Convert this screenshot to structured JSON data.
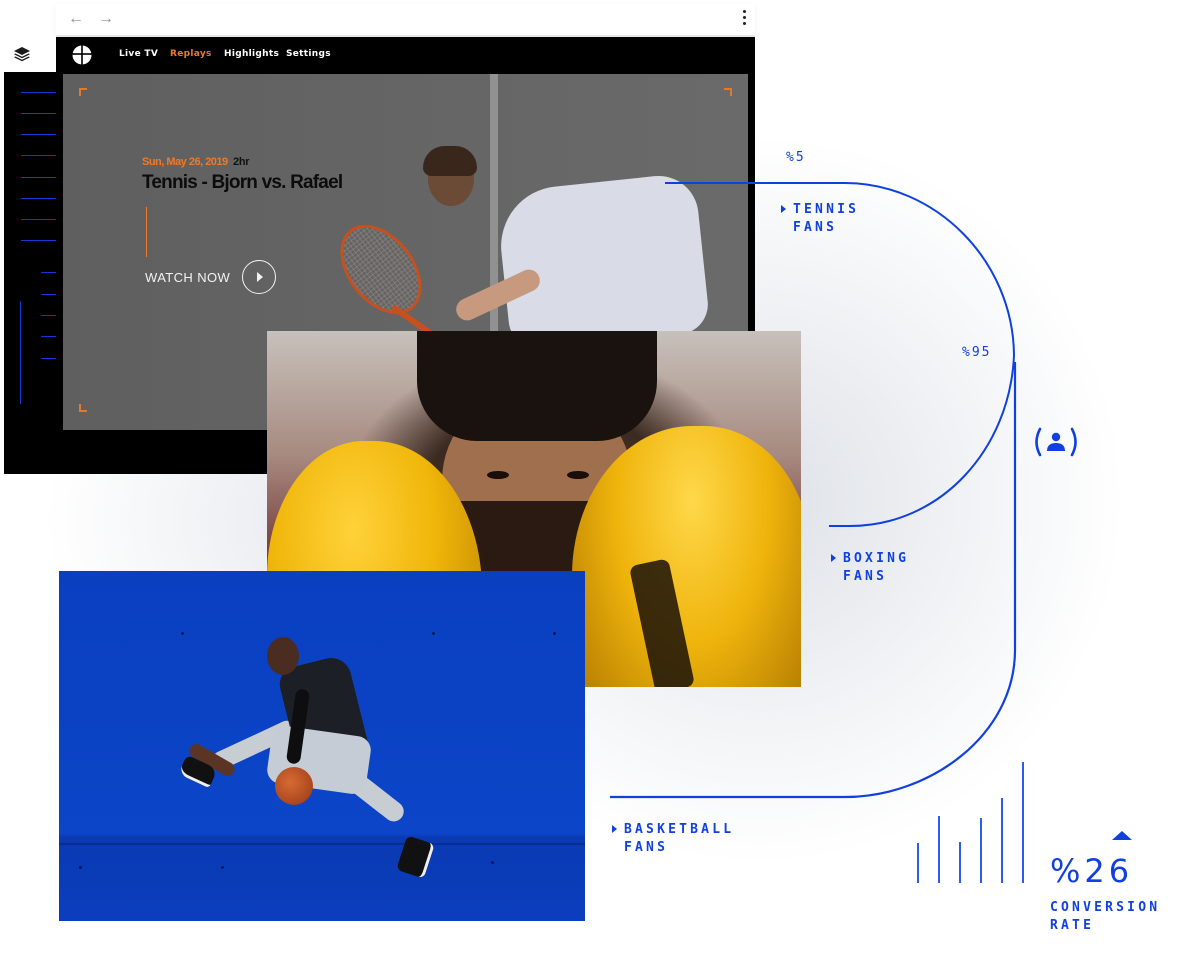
{
  "browser": {
    "back_icon": "←",
    "forward_icon": "→",
    "menu_icon": "kebab-menu"
  },
  "app": {
    "nav": [
      {
        "label": "Live TV",
        "active": false
      },
      {
        "label": "Replays",
        "active": true
      },
      {
        "label": "Highlights",
        "active": false
      },
      {
        "label": "Settings",
        "active": false
      }
    ],
    "accent_color": "#f0782a"
  },
  "hero": {
    "date": "Sun, May 26, 2019",
    "duration": "2hr",
    "title": "Tennis - Bjorn vs. Rafael",
    "cta_label": "WATCH NOW"
  },
  "audience": {
    "accent_color": "#1140e0",
    "segments": [
      {
        "percent_label": "%5",
        "line1": "TENNIS",
        "line2": "FANS"
      },
      {
        "percent_label": "%95",
        "line1": "BOXING",
        "line2": "FANS"
      },
      {
        "percent_label": "",
        "line1": "BASKETBALL",
        "line2": "FANS"
      }
    ]
  },
  "conversion": {
    "value": "%26",
    "label_line1": "CONVERSION",
    "label_line2": "RATE",
    "trend": "up",
    "bars_relative": [
      0.33,
      0.55,
      0.34,
      0.54,
      0.7,
      1.0
    ]
  }
}
